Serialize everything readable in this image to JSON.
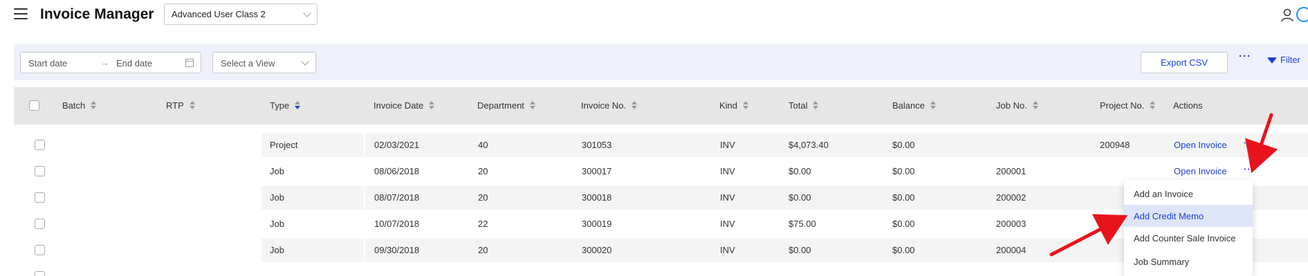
{
  "header": {
    "title": "Invoice Manager",
    "user_class": "Advanced User Class 2"
  },
  "filters": {
    "start_date_placeholder": "Start date",
    "arrow": "→",
    "end_date_placeholder": "End date",
    "view_placeholder": "Select a View",
    "export_label": "Export CSV",
    "more_label": "···",
    "filter_label": "Filter"
  },
  "table": {
    "columns": [
      "Batch",
      "RTP",
      "Type",
      "Invoice Date",
      "Department",
      "Invoice No.",
      "Kind",
      "Total",
      "Balance",
      "Job No.",
      "Project No.",
      "Actions"
    ],
    "sorted_column": "Type",
    "rows": [
      {
        "type": "Project",
        "invoice_date": "02/03/2021",
        "department": "40",
        "invoice_no": "301053",
        "kind": "INV",
        "total": "$4,073.40",
        "balance": "$0.00",
        "job_no": "",
        "project_no": "200948",
        "action": "Open Invoice",
        "more": "···"
      },
      {
        "type": "Job",
        "invoice_date": "08/06/2018",
        "department": "20",
        "invoice_no": "300017",
        "kind": "INV",
        "total": "$0.00",
        "balance": "$0.00",
        "job_no": "200001",
        "project_no": "",
        "action": "Open Invoice",
        "more": "···"
      },
      {
        "type": "Job",
        "invoice_date": "08/07/2018",
        "department": "20",
        "invoice_no": "300018",
        "kind": "INV",
        "total": "$0.00",
        "balance": "$0.00",
        "job_no": "200002",
        "project_no": "",
        "action": "",
        "more": ""
      },
      {
        "type": "Job",
        "invoice_date": "10/07/2018",
        "department": "22",
        "invoice_no": "300019",
        "kind": "INV",
        "total": "$75.00",
        "balance": "$0.00",
        "job_no": "200003",
        "project_no": "",
        "action": "",
        "more": ""
      },
      {
        "type": "Job",
        "invoice_date": "09/30/2018",
        "department": "20",
        "invoice_no": "300020",
        "kind": "INV",
        "total": "$0.00",
        "balance": "$0.00",
        "job_no": "200004",
        "project_no": "",
        "action": "",
        "more": ""
      }
    ]
  },
  "actions_menu": {
    "items": [
      "Add an Invoice",
      "Add Credit Memo",
      "Add Counter Sale Invoice",
      "Job Summary"
    ],
    "highlighted": "Add Credit Memo"
  },
  "colors": {
    "accent": "#1a3fd6",
    "filter_bar_bg": "#eef1fb",
    "header_row_bg": "#e6e6e6",
    "menu_hover_bg": "#dfe5f8",
    "annotation_arrow": "#e8141c"
  }
}
